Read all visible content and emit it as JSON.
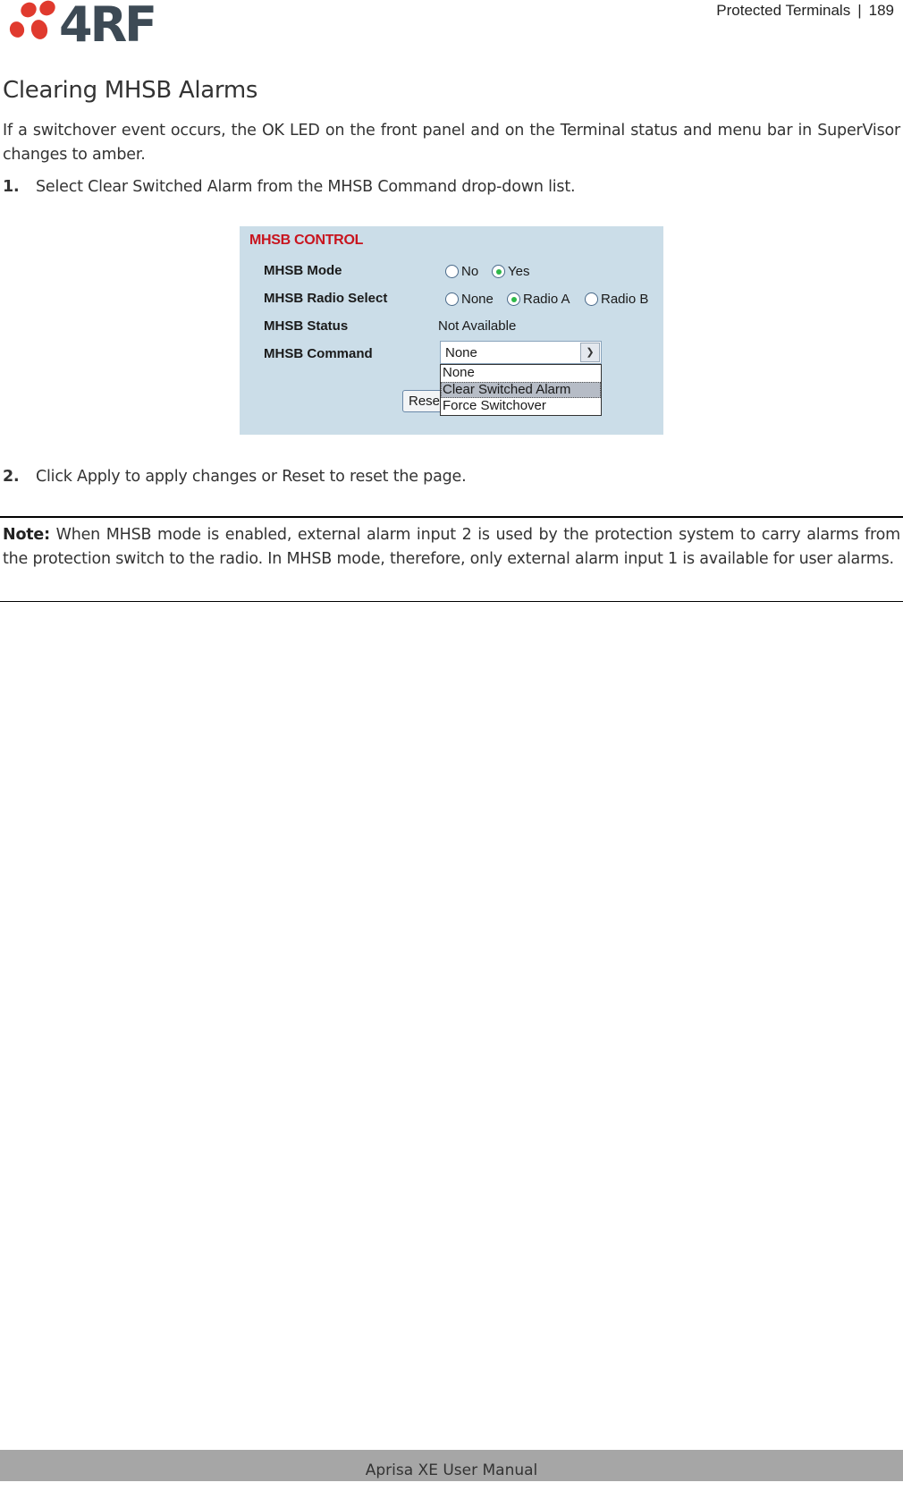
{
  "header": {
    "logo_text": "4RF",
    "section": "Protected Terminals",
    "separator": "|",
    "page_number": "189"
  },
  "title": "Clearing MHSB Alarms",
  "intro": "If a switchover event occurs, the OK LED on the front panel and on the Terminal status and menu bar in SuperVisor changes to amber.",
  "steps": [
    {
      "num": "1.",
      "text": "Select Clear Switched Alarm from the MHSB Command drop-down list."
    },
    {
      "num": "2.",
      "text": "Click Apply to apply changes or Reset to reset the page."
    }
  ],
  "panel": {
    "title": "MHSB CONTROL",
    "title_color": "#c8141e",
    "background": "#cbdde8",
    "mode": {
      "label": "MHSB Mode",
      "options": [
        "No",
        "Yes"
      ],
      "selected": "Yes"
    },
    "radio_select": {
      "label": "MHSB Radio Select",
      "options": [
        "None",
        "Radio A",
        "Radio B"
      ],
      "selected": "Radio A"
    },
    "status": {
      "label": "MHSB Status",
      "value": "Not Available"
    },
    "command": {
      "label": "MHSB Command",
      "value": "None",
      "options": [
        "None",
        "Clear Switched Alarm",
        "Force Switchover"
      ],
      "highlighted": "Clear Switched Alarm"
    },
    "reset_button": "Reset"
  },
  "note": {
    "label": "Note:",
    "text": " When MHSB mode is enabled, external alarm input 2 is used by the protection system to carry alarms from the protection switch to the radio. In MHSB mode, therefore, only external alarm input 1 is available for user alarms."
  },
  "footer": "Aprisa XE User Manual"
}
